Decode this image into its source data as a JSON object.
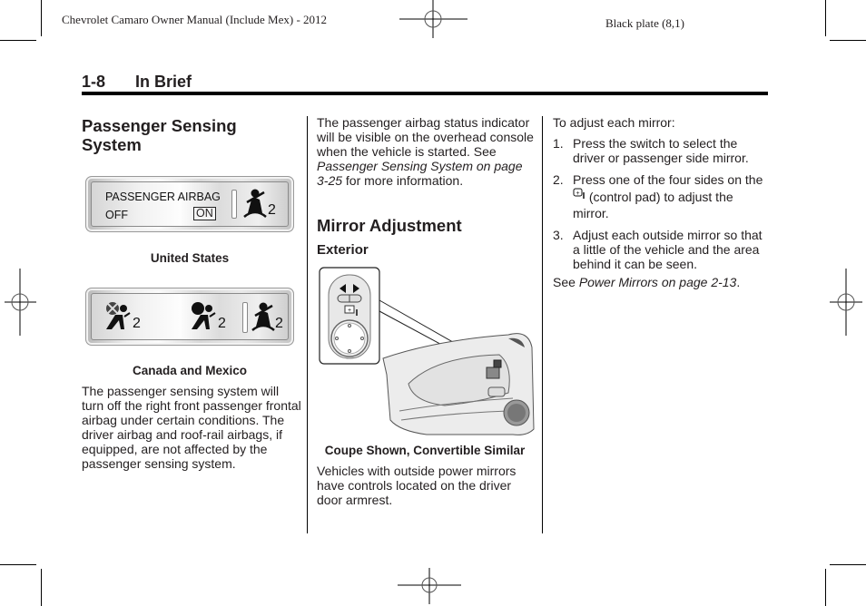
{
  "header": {
    "manual_title": "Chevrolet Camaro Owner Manual (Include Mex) - 2012",
    "plate": "Black plate (8,1)"
  },
  "section": {
    "number": "1-8",
    "name": "In Brief"
  },
  "column1": {
    "heading": "Passenger Sensing System",
    "figure_us": {
      "line1": "PASSENGER AIRBAG",
      "off_label": "OFF",
      "on_label": "ON",
      "seatbelt_suffix": "2",
      "caption": "United States",
      "icons": [
        "seatbelt-reminder-icon"
      ]
    },
    "figure_canada": {
      "suffixes": [
        "2",
        "2",
        "2"
      ],
      "caption": "Canada and Mexico",
      "icons": [
        "airbag-off-icon",
        "airbag-on-icon",
        "seatbelt-reminder-icon"
      ]
    },
    "body": "The passenger sensing system will turn off the right front passenger frontal airbag under certain conditions. The driver airbag and roof-rail airbags, if equipped, are not affected by the passenger sensing system."
  },
  "column2": {
    "intro_pre": "The passenger airbag status indicator will be visible on the overhead console when the vehicle is started. See ",
    "intro_link": "Passenger Sensing System on page 3-25",
    "intro_post": " for more information.",
    "heading": "Mirror Adjustment",
    "subheading": "Exterior",
    "figure_caption": "Coupe Shown, Convertible Similar",
    "body": "Vehicles with outside power mirrors have controls located on the driver door armrest."
  },
  "column3": {
    "intro": "To adjust each mirror:",
    "steps": [
      {
        "num": "1.",
        "text": "Press the switch to select the driver or passenger side mirror."
      },
      {
        "num": "2.",
        "pre": "Press one of the four sides on the ",
        "post": " (control pad) to adjust the mirror."
      },
      {
        "num": "3.",
        "text": "Adjust each outside mirror so that a little of the vehicle and the area behind it can be seen."
      }
    ],
    "see_pre": "See ",
    "see_link": "Power Mirrors on page 2-13",
    "see_post": "."
  }
}
